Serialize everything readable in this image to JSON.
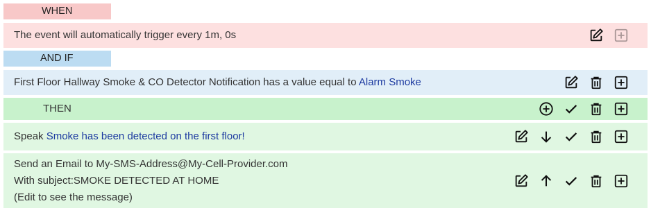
{
  "when": {
    "label": "WHEN",
    "text": "The event will automatically trigger every 1m, 0s"
  },
  "andif": {
    "label": "AND IF",
    "text_prefix": "First Floor Hallway Smoke & CO Detector Notification has a value equal to ",
    "value": "Alarm Smoke"
  },
  "then": {
    "label": "THEN"
  },
  "speak": {
    "prefix": "Speak ",
    "message": "Smoke has been detected on the first floor!"
  },
  "email": {
    "line1": "Send an Email to My-SMS-Address@My-Cell-Provider.com",
    "line2": "With subject:SMOKE DETECTED AT HOME",
    "line3": "(Edit to see the message)"
  },
  "icons": {
    "edit": "edit-icon",
    "add": "add-box-icon",
    "delete": "trash-icon",
    "check": "check-icon",
    "add_circle": "add-circle-icon",
    "down": "arrow-down-icon",
    "up": "arrow-up-icon"
  },
  "colors": {
    "when_tag": "#f8c8c8",
    "when_row": "#fde0e0",
    "if_tag": "#bcdcf2",
    "if_row": "#e1eef8",
    "then_row": "#c8f2cc",
    "action_row": "#e0f7e2",
    "highlight_text": "#1c3aa0"
  }
}
